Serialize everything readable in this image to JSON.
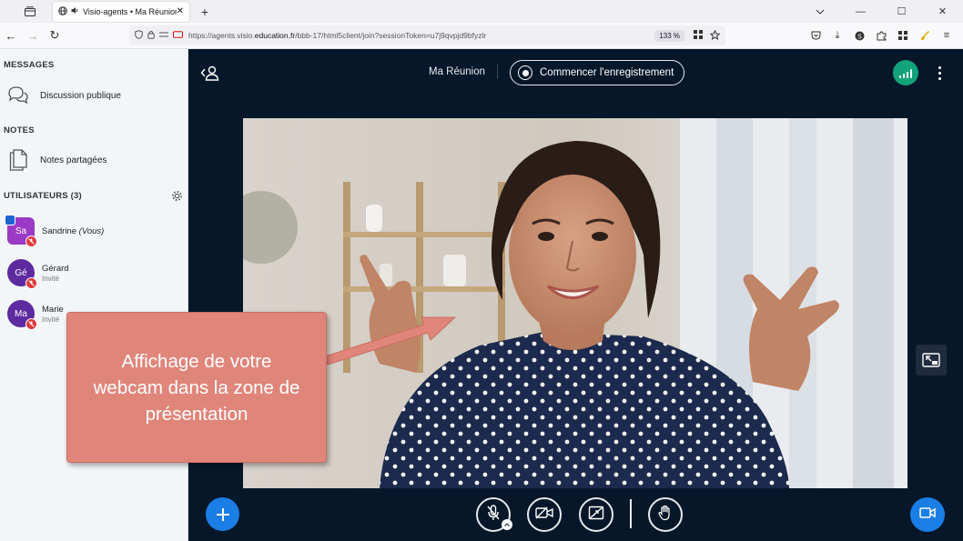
{
  "browser": {
    "tab_title": "Visio-agents • Ma Réunion",
    "url_prefix": "https://agents.visio.",
    "url_host": "education.fr",
    "url_path": "/bbb-17/html5client/join?sessionToken=u7j9qvpjd9bfyzlr",
    "zoom": "133 %"
  },
  "sidebar": {
    "messages_title": "MESSAGES",
    "public_chat": "Discussion publique",
    "notes_title": "NOTES",
    "shared_notes": "Notes partagées",
    "users_title": "UTILISATEURS (3)",
    "users": [
      {
        "initials": "Sa",
        "name": "Sandrine",
        "suffix": "(Vous)",
        "role": ""
      },
      {
        "initials": "Gé",
        "name": "Gérard",
        "suffix": "",
        "role": "Invité"
      },
      {
        "initials": "Ma",
        "name": "Marie",
        "suffix": "",
        "role": "Invité"
      }
    ]
  },
  "meeting": {
    "title": "Ma Réunion",
    "record_label": "Commencer l'enregistrement"
  },
  "callout": {
    "text": "Affichage de votre webcam dans la zone de présentation"
  },
  "colors": {
    "accent": "#1b7ee6",
    "callout": "#e0857a",
    "background": "#06172a",
    "connection": "#12a37a"
  }
}
